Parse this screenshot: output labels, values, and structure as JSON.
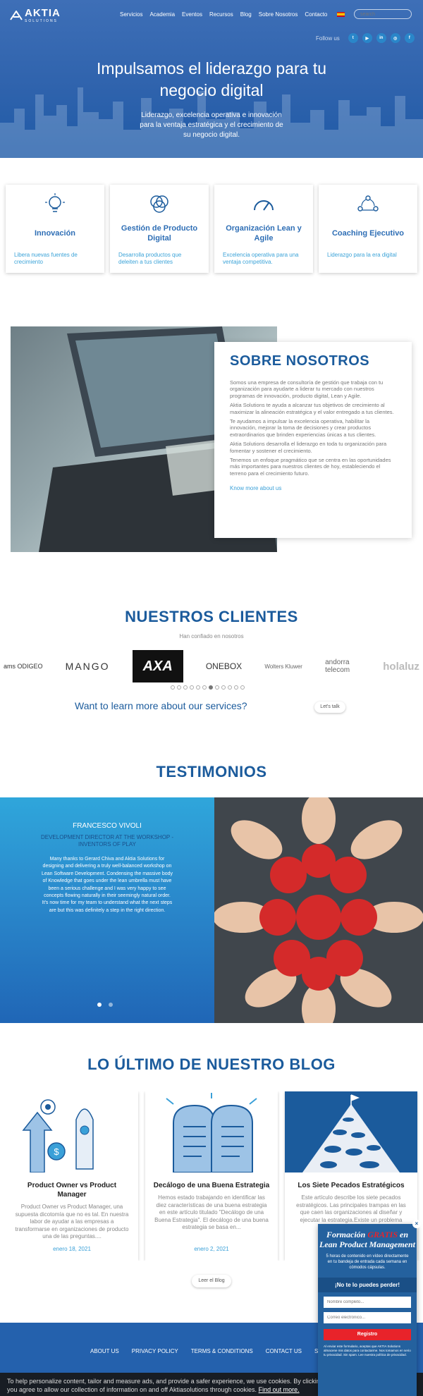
{
  "header": {
    "logo_text": "AKTIA",
    "logo_sub": "SOLUTIONS",
    "nav": [
      "Servicios",
      "Academia",
      "Eventos",
      "Recursos",
      "Blog",
      "Sobre Nosotros",
      "Contacto"
    ],
    "search_placeholder": "search",
    "follow_label": "Follow us",
    "social": [
      "twitter-icon",
      "youtube-icon",
      "linkedin-icon",
      "instagram-icon",
      "facebook-icon"
    ]
  },
  "hero": {
    "title_line1": "Impulsamos el liderazgo para tu",
    "title_line2": "negocio digital",
    "sub_line1": "Liderazgo, excelencia operativa e innovación",
    "sub_line2": "para la ventaja estratégica y el crecimiento de",
    "sub_line3": "su negocio digital."
  },
  "services": [
    {
      "title": "Innovación",
      "desc": "Libera nuevas fuentes de crecimiento"
    },
    {
      "title": "Gestión de Producto Digital",
      "desc": "Desarrolla productos que deleiten a tus clientes"
    },
    {
      "title": "Organización Lean y Agile",
      "desc": "Excelencia operativa para una ventaja competitiva."
    },
    {
      "title": "Coaching Ejecutivo",
      "desc": "Liderazgo para la era digital"
    }
  ],
  "about": {
    "title": "SOBRE NOSOTROS",
    "paragraphs": [
      "Somos una empresa de consultoría de gestión que trabaja con tu organización para ayudarte a liderar tu mercado con nuestros programas de innovación, producto digital, Lean y Agile.",
      "Aktia Solutions te ayuda a alcanzar tus objetivos de crecimiento al maximizar la alineación estratégica y el valor entregado a tus clientes.",
      "Te ayudamos a impulsar la excelencia operativa, habilitar la innovación, mejorar la toma de decisiones y crear productos extraordinarios que brinden experiencias únicas a tus clientes.",
      "Aktia Solutions desarrolla el liderazgo en toda tu organización para fomentar y sostener el crecimiento.",
      "Tenemos un enfoque pragmático que se centra en las oportunidades más importantes para nuestros clientes de hoy, estableciendo el terreno para el crecimiento futuro."
    ],
    "link": "Know more about us"
  },
  "clients": {
    "title": "NUESTROS CLIENTES",
    "subtitle": "Han confiado en nosotros",
    "logos": [
      "ams ODIGEO",
      "MANGO",
      "AXA",
      "ONEBOX",
      "Wolters Kluwer",
      "andorra telecom",
      "holaluz"
    ],
    "carousel_dots": 12,
    "active_dot": 7,
    "cta_text": "Want to learn more about our services?",
    "cta_button": "Let's talk"
  },
  "testimonials": {
    "title": "TESTIMONIOS",
    "name": "FRANCESCO VIVOLI",
    "role": "DEVELOPMENT DIRECTOR AT THE WORKSHOP - INVENTORS OF PLAY",
    "quote": "Many thanks to Gerard Chiva and Aktia Solutions for designing and delivering a truly well-balanced workshop on Lean Software Development. Condensing the massive body of Knowledge that goes under the lean umbrella must have been a serious challenge and I was very happy to see concepts flowing naturally in their seemingly natural order. It's now time for my team to understand what the next steps are but this was definitely a step in the right direction."
  },
  "blog": {
    "title": "LO ÚLTIMO DE NUESTRO BLOG",
    "posts": [
      {
        "title": "Product Owner vs Product Manager",
        "excerpt": "Product Owner vs Product Manager, una supuesta dicotomía que no es tal. En nuestra labor de ayudar a las empresas a transformarse en organizaciones de producto una de las preguntas....",
        "date": "enero 18, 2021"
      },
      {
        "title": "Decálogo de una Buena Estrategia",
        "excerpt": "Hemos estado trabajando en identificar las diez características de una buena estrategia en este artículo titulado \"Decálogo de una Buena Estrategia\". El decálogo de una buena estrategia se basa en...",
        "date": "enero 2, 2021"
      },
      {
        "title": "Los Siete Pecados Estratégicos",
        "excerpt": "Este artículo describe los siete pecados estratégicos. Las principales trampas en las que caen las organizaciones al diseñar y ejecutar la estrategia.Existe un problema endémico...",
        "date": ""
      }
    ],
    "button": "Leer el Blog"
  },
  "footer": {
    "links": [
      "ABOUT US",
      "PRIVACY POLICY",
      "TERMS & CONDITIONS",
      "CONTACT US",
      "SUBS"
    ]
  },
  "cookie": {
    "line1": "To help personalize content, tailor and measure ads, and provide a safer experience, we use cookies. By clicking or n",
    "line2": "you agree to allow our collection of information on and off Aktiasolutions through cookies.",
    "link": "Find out more."
  },
  "popup": {
    "title_pre": "Formación ",
    "title_highlight": "GRATIS",
    "title_post": " en Lean Product Management",
    "desc": "5 horas de contenido en vídeo directamente en tu bandeja de entrada cada semana en cómodos cápsulas.",
    "band": "¡No te lo puedes perder!",
    "name_placeholder": "Nombre completo...",
    "email_placeholder": "Correo electrónico...",
    "button": "Registro",
    "note": "Al enviar este formulario, aceptas que AKTIA Solutions almacene mis datos para contactarme. Nos tomamos en serio tu privacidad. Sin spam. Lee nuestra política de privacidad."
  },
  "colors": {
    "primary": "#1b5b9c",
    "accent": "#3aa0d8",
    "hero": "#2f63ad",
    "popup_red": "#e8232a"
  }
}
